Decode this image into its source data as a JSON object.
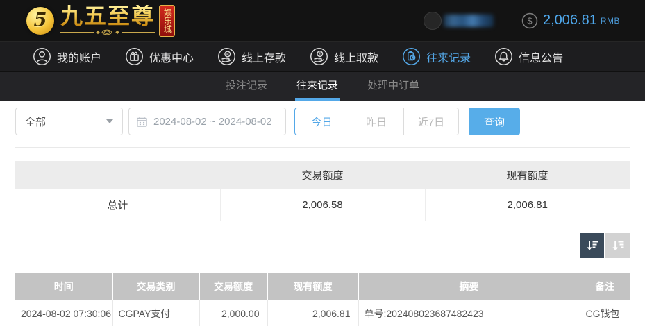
{
  "colors": {
    "accent_blue": "#54a8e8",
    "gold": "#e8b43c",
    "badge_red": "#b51212",
    "topbar_bg": "#131313",
    "nav_bg": "#1d1d1f",
    "subnav_bg": "#242427",
    "records_header_gray": "#c3c3c3",
    "summary_header_gray": "#ececec",
    "sort_active_bg": "#3a4a5a",
    "sort_inactive_bg": "#d2d2d2",
    "query_button_bg": "#57ade9"
  },
  "header": {
    "logo": {
      "monogram": "5",
      "brand": "九五至尊",
      "badge": "娱乐城"
    },
    "balance": {
      "currency_symbol": "$",
      "amount": "2,006.81",
      "currency": "RMB"
    }
  },
  "nav": {
    "items": [
      {
        "label": "我的账户",
        "icon": "user-icon"
      },
      {
        "label": "优惠中心",
        "icon": "gift-icon"
      },
      {
        "label": "线上存款",
        "icon": "deposit-icon"
      },
      {
        "label": "线上取款",
        "icon": "withdraw-icon"
      },
      {
        "label": "往来记录",
        "icon": "records-icon",
        "active": true
      },
      {
        "label": "信息公告",
        "icon": "bell-icon"
      }
    ]
  },
  "tabs": {
    "items": [
      {
        "label": "投注记录"
      },
      {
        "label": "往来记录",
        "active": true
      },
      {
        "label": "处理中订单"
      }
    ]
  },
  "filters": {
    "type_select": {
      "value": "全部"
    },
    "date_range": {
      "value": "2024-08-02 ~ 2024-08-02"
    },
    "quick": {
      "today": "今日",
      "yesterday": "昨日",
      "last7": "近7日",
      "active": "今日"
    },
    "query_label": "查询"
  },
  "summary_table": {
    "headers": [
      "",
      "交易额度",
      "现有额度"
    ],
    "row_label": "总计",
    "row_values": [
      "2,006.58",
      "2,006.81"
    ]
  },
  "records_table": {
    "headers": [
      "时间",
      "交易类别",
      "交易额度",
      "现有额度",
      "摘要",
      "备注"
    ],
    "rows": [
      {
        "time": "2024-08-02 07:30:06",
        "type": "CGPAY支付",
        "amount": "2,000.00",
        "balance": "2,006.81",
        "summary": "单号:202408023687482423",
        "remark": "CG钱包"
      }
    ]
  }
}
